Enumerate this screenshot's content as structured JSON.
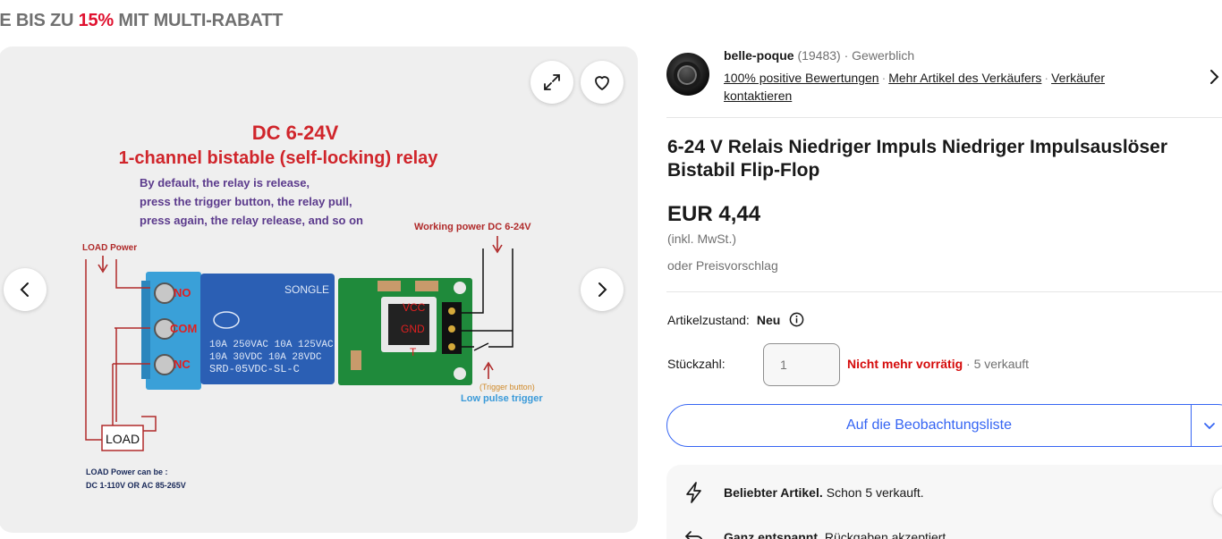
{
  "promo": {
    "prefix": "IE BIS ZU ",
    "percent": "15%",
    "suffix": " MIT MULTI-RABATT",
    "percent_color": "#e0112f"
  },
  "gallery": {
    "image": {
      "heading": "DC 6-24V",
      "subheading": "1-channel bistable (self-locking) relay",
      "desc_lines": [
        "By default, the relay is release,",
        "press the trigger button, the relay pull,",
        "press again, the relay release, and so on"
      ],
      "load_power": "LOAD Power",
      "working_power": "Working power DC 6-24V",
      "terminals": [
        "NO",
        "COM",
        "NC"
      ],
      "relay_brand": "SONGLE",
      "relay_lines": [
        "10A 250VAC  10A 125VAC",
        "10A  30VDC  10A  28VDC",
        "SRD-05VDC-SL-C"
      ],
      "pins": [
        "VCC",
        "GND",
        "T"
      ],
      "trigger_button": "(Trigger button)",
      "low_pulse": "Low pulse trigger",
      "load_label": "LOAD",
      "load_note_lines": [
        "LOAD Power can be :",
        "DC 1-110V OR AC 85-265V"
      ]
    }
  },
  "seller": {
    "name": "belle-poque",
    "feedback_count": "(19483)",
    "type": "Gewerblich",
    "positive": "100% positive Bewertungen",
    "more_items": "Mehr Artikel des Verkäufers",
    "contact": "Verkäufer kontaktieren"
  },
  "listing": {
    "title": "6-24 V Relais Niedriger Impuls Niedriger Impulsauslöser Bistabil Flip-Flop",
    "price": "EUR 4,44",
    "vat": "(inkl. MwSt.)",
    "offer": "oder Preisvorschlag",
    "condition_label": "Artikelzustand:",
    "condition_value": "Neu",
    "qty_label": "Stückzahl:",
    "qty_value": "1",
    "out_of_stock": "Nicht mehr vorrätig",
    "sold": "5 verkauft",
    "watch_label": "Auf die Beobachtungsliste"
  },
  "highlights": [
    {
      "icon": "lightning-icon",
      "bold": "Beliebter Artikel.",
      "text": "Schon 5 verkauft."
    },
    {
      "icon": "return-icon",
      "bold": "Ganz entspannt.",
      "text": "Rückgaben akzeptiert."
    }
  ],
  "colors": {
    "accent": "#3665f3",
    "out_of_stock": "#d50b0b",
    "muted": "#707070"
  }
}
